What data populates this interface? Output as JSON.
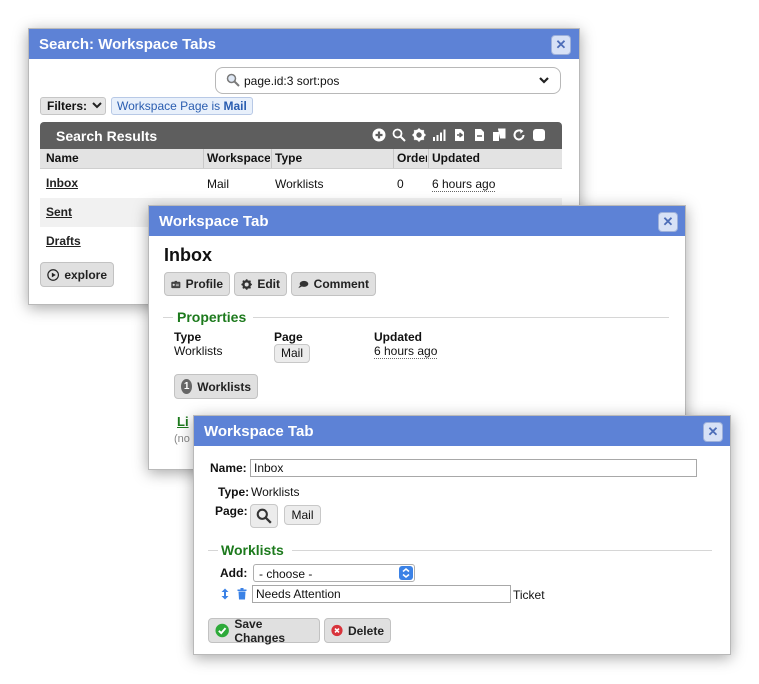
{
  "search_window": {
    "title": "Search: Workspace Tabs",
    "query": "page.id:3 sort:pos",
    "filters_label": "Filters:",
    "filter_chip": {
      "prefix": "Workspace Page is ",
      "value": "Mail"
    },
    "results_title": "Search Results",
    "columns": [
      "Name",
      "Workspace",
      "Type",
      "Order",
      "Updated"
    ],
    "rows": [
      {
        "name": "Inbox",
        "workspace": "Mail",
        "type": "Worklists",
        "order": "0",
        "updated": "6 hours ago"
      },
      {
        "name": "Sent"
      },
      {
        "name": "Drafts"
      }
    ],
    "explore_label": "explore"
  },
  "profile_window": {
    "title": "Workspace Tab",
    "heading": "Inbox",
    "buttons": {
      "profile": "Profile",
      "edit": "Edit",
      "comment": "Comment"
    },
    "properties_title": "Properties",
    "props": {
      "type_label": "Type",
      "type_value": "Worklists",
      "page_label": "Page",
      "page_value": "Mail",
      "updated_label": "Updated",
      "updated_value": "6 hours ago"
    },
    "worklists_badge": {
      "count": "1",
      "label": "Worklists"
    },
    "links_partial": "Li",
    "none_partial": "(no"
  },
  "edit_window": {
    "title": "Workspace Tab",
    "name_label": "Name:",
    "name_value": "Inbox",
    "type_label": "Type:",
    "type_value": "Worklists",
    "page_label": "Page:",
    "page_value": "Mail",
    "worklists_title": "Worklists",
    "add_label": "Add:",
    "add_selected": "- choose -",
    "worklist_items": [
      {
        "name": "Needs Attention",
        "type": "Ticket"
      }
    ],
    "save_label": "Save Changes",
    "delete_label": "Delete"
  },
  "colors": {
    "titlebar": "#5d82d6",
    "section_green": "#1d7a1d",
    "results_bar": "#5e5e5e",
    "save_green": "#2eaa3a",
    "delete_red": "#d8333b"
  }
}
